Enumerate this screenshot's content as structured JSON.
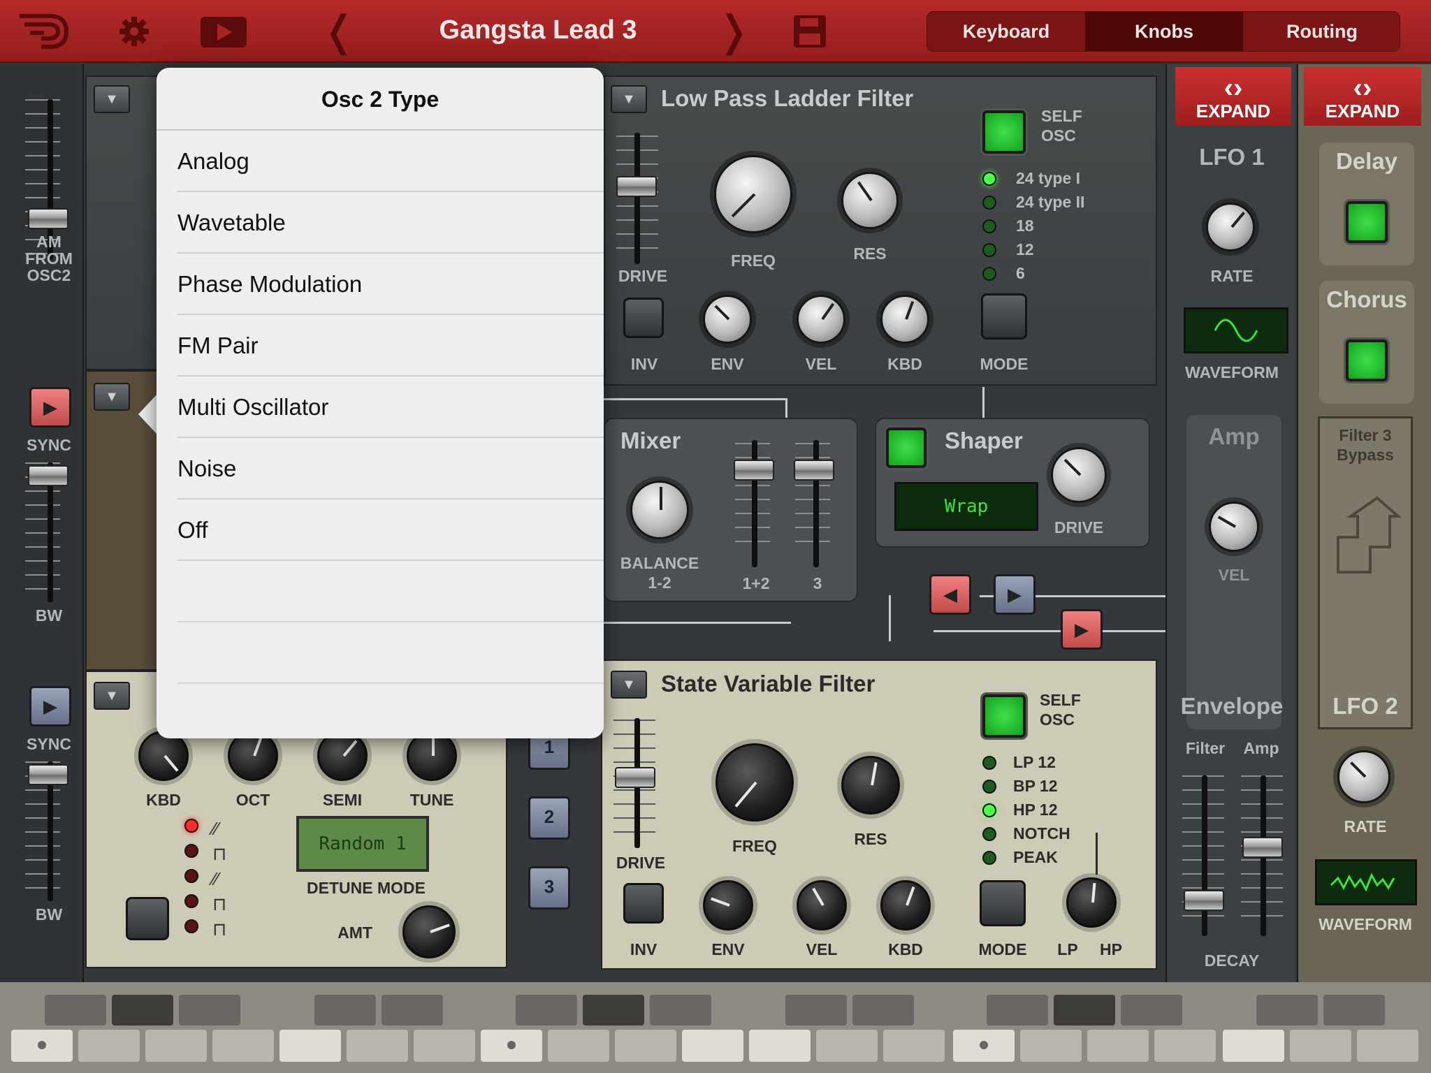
{
  "topbar": {
    "title": "Gangsta Lead 3",
    "tabs": [
      {
        "label": "Keyboard",
        "active": false
      },
      {
        "label": "Knobs",
        "active": true
      },
      {
        "label": "Routing",
        "active": false
      }
    ],
    "icons": [
      "logo-icon",
      "gear-icon",
      "play-video-icon",
      "chevron-left-icon",
      "chevron-right-icon",
      "save-icon"
    ]
  },
  "popover": {
    "title": "Osc 2 Type",
    "items": [
      "Analog",
      "Wavetable",
      "Phase Modulation",
      "FM Pair",
      "Multi Oscillator",
      "Noise",
      "Off"
    ]
  },
  "left_strip": {
    "am_label": "AM\nFROM\nOSC2",
    "sync1": "SYNC",
    "bw1": "BW",
    "sync2": "SYNC",
    "bw2": "BW"
  },
  "osc3": {
    "labels": [
      "KBD",
      "OCT",
      "SEMI",
      "TUNE"
    ],
    "display": "Random 1",
    "detune_mode": "DETUNE MODE",
    "amt": "AMT",
    "numbers": [
      "1",
      "2",
      "3"
    ]
  },
  "lp_filter": {
    "title": "Low Pass Ladder Filter",
    "self_osc": "SELF\nOSC",
    "types": [
      {
        "label": "24 type I",
        "on": true
      },
      {
        "label": "24 type II",
        "on": false
      },
      {
        "label": "18",
        "on": false
      },
      {
        "label": "12",
        "on": false
      },
      {
        "label": "6",
        "on": false
      }
    ],
    "knob_labels": {
      "freq": "FREQ",
      "res": "RES",
      "drive": "DRIVE",
      "inv": "INV",
      "env": "ENV",
      "vel": "VEL",
      "kbd": "KBD",
      "mode": "MODE"
    }
  },
  "mixer": {
    "title": "Mixer",
    "balance": "BALANCE\n1-2",
    "ch12": "1+2",
    "ch3": "3"
  },
  "shaper": {
    "title": "Shaper",
    "display": "Wrap",
    "drive": "DRIVE"
  },
  "sv_filter": {
    "title": "State Variable Filter",
    "self_osc": "SELF\nOSC",
    "types": [
      {
        "label": "LP 12",
        "on": false
      },
      {
        "label": "BP 12",
        "on": false
      },
      {
        "label": "HP 12",
        "on": true
      },
      {
        "label": "NOTCH",
        "on": false
      },
      {
        "label": "PEAK",
        "on": false
      }
    ],
    "knob_labels": {
      "freq": "FREQ",
      "res": "RES",
      "drive": "DRIVE",
      "inv": "INV",
      "env": "ENV",
      "vel": "VEL",
      "kbd": "KBD",
      "mode": "MODE",
      "lp": "LP",
      "hp": "HP"
    }
  },
  "lfo1": {
    "expand": "EXPAND",
    "title": "LFO 1",
    "rate": "RATE",
    "waveform": "WAVEFORM"
  },
  "amp": {
    "title": "Amp",
    "vel": "VEL"
  },
  "envelope": {
    "title": "Envelope",
    "filter": "Filter",
    "amp": "Amp",
    "decay": "DECAY"
  },
  "fx": {
    "expand": "EXPAND",
    "delay": "Delay",
    "chorus": "Chorus",
    "filter_bypass": "Filter 3\nBypass"
  },
  "lfo2": {
    "title": "LFO 2",
    "rate": "RATE",
    "waveform": "WAVEFORM"
  },
  "colors": {
    "topbar": "#a52424",
    "accent_green": "#3fe04a",
    "cream": "#cdcbb6",
    "popover": "#eeeeee"
  }
}
